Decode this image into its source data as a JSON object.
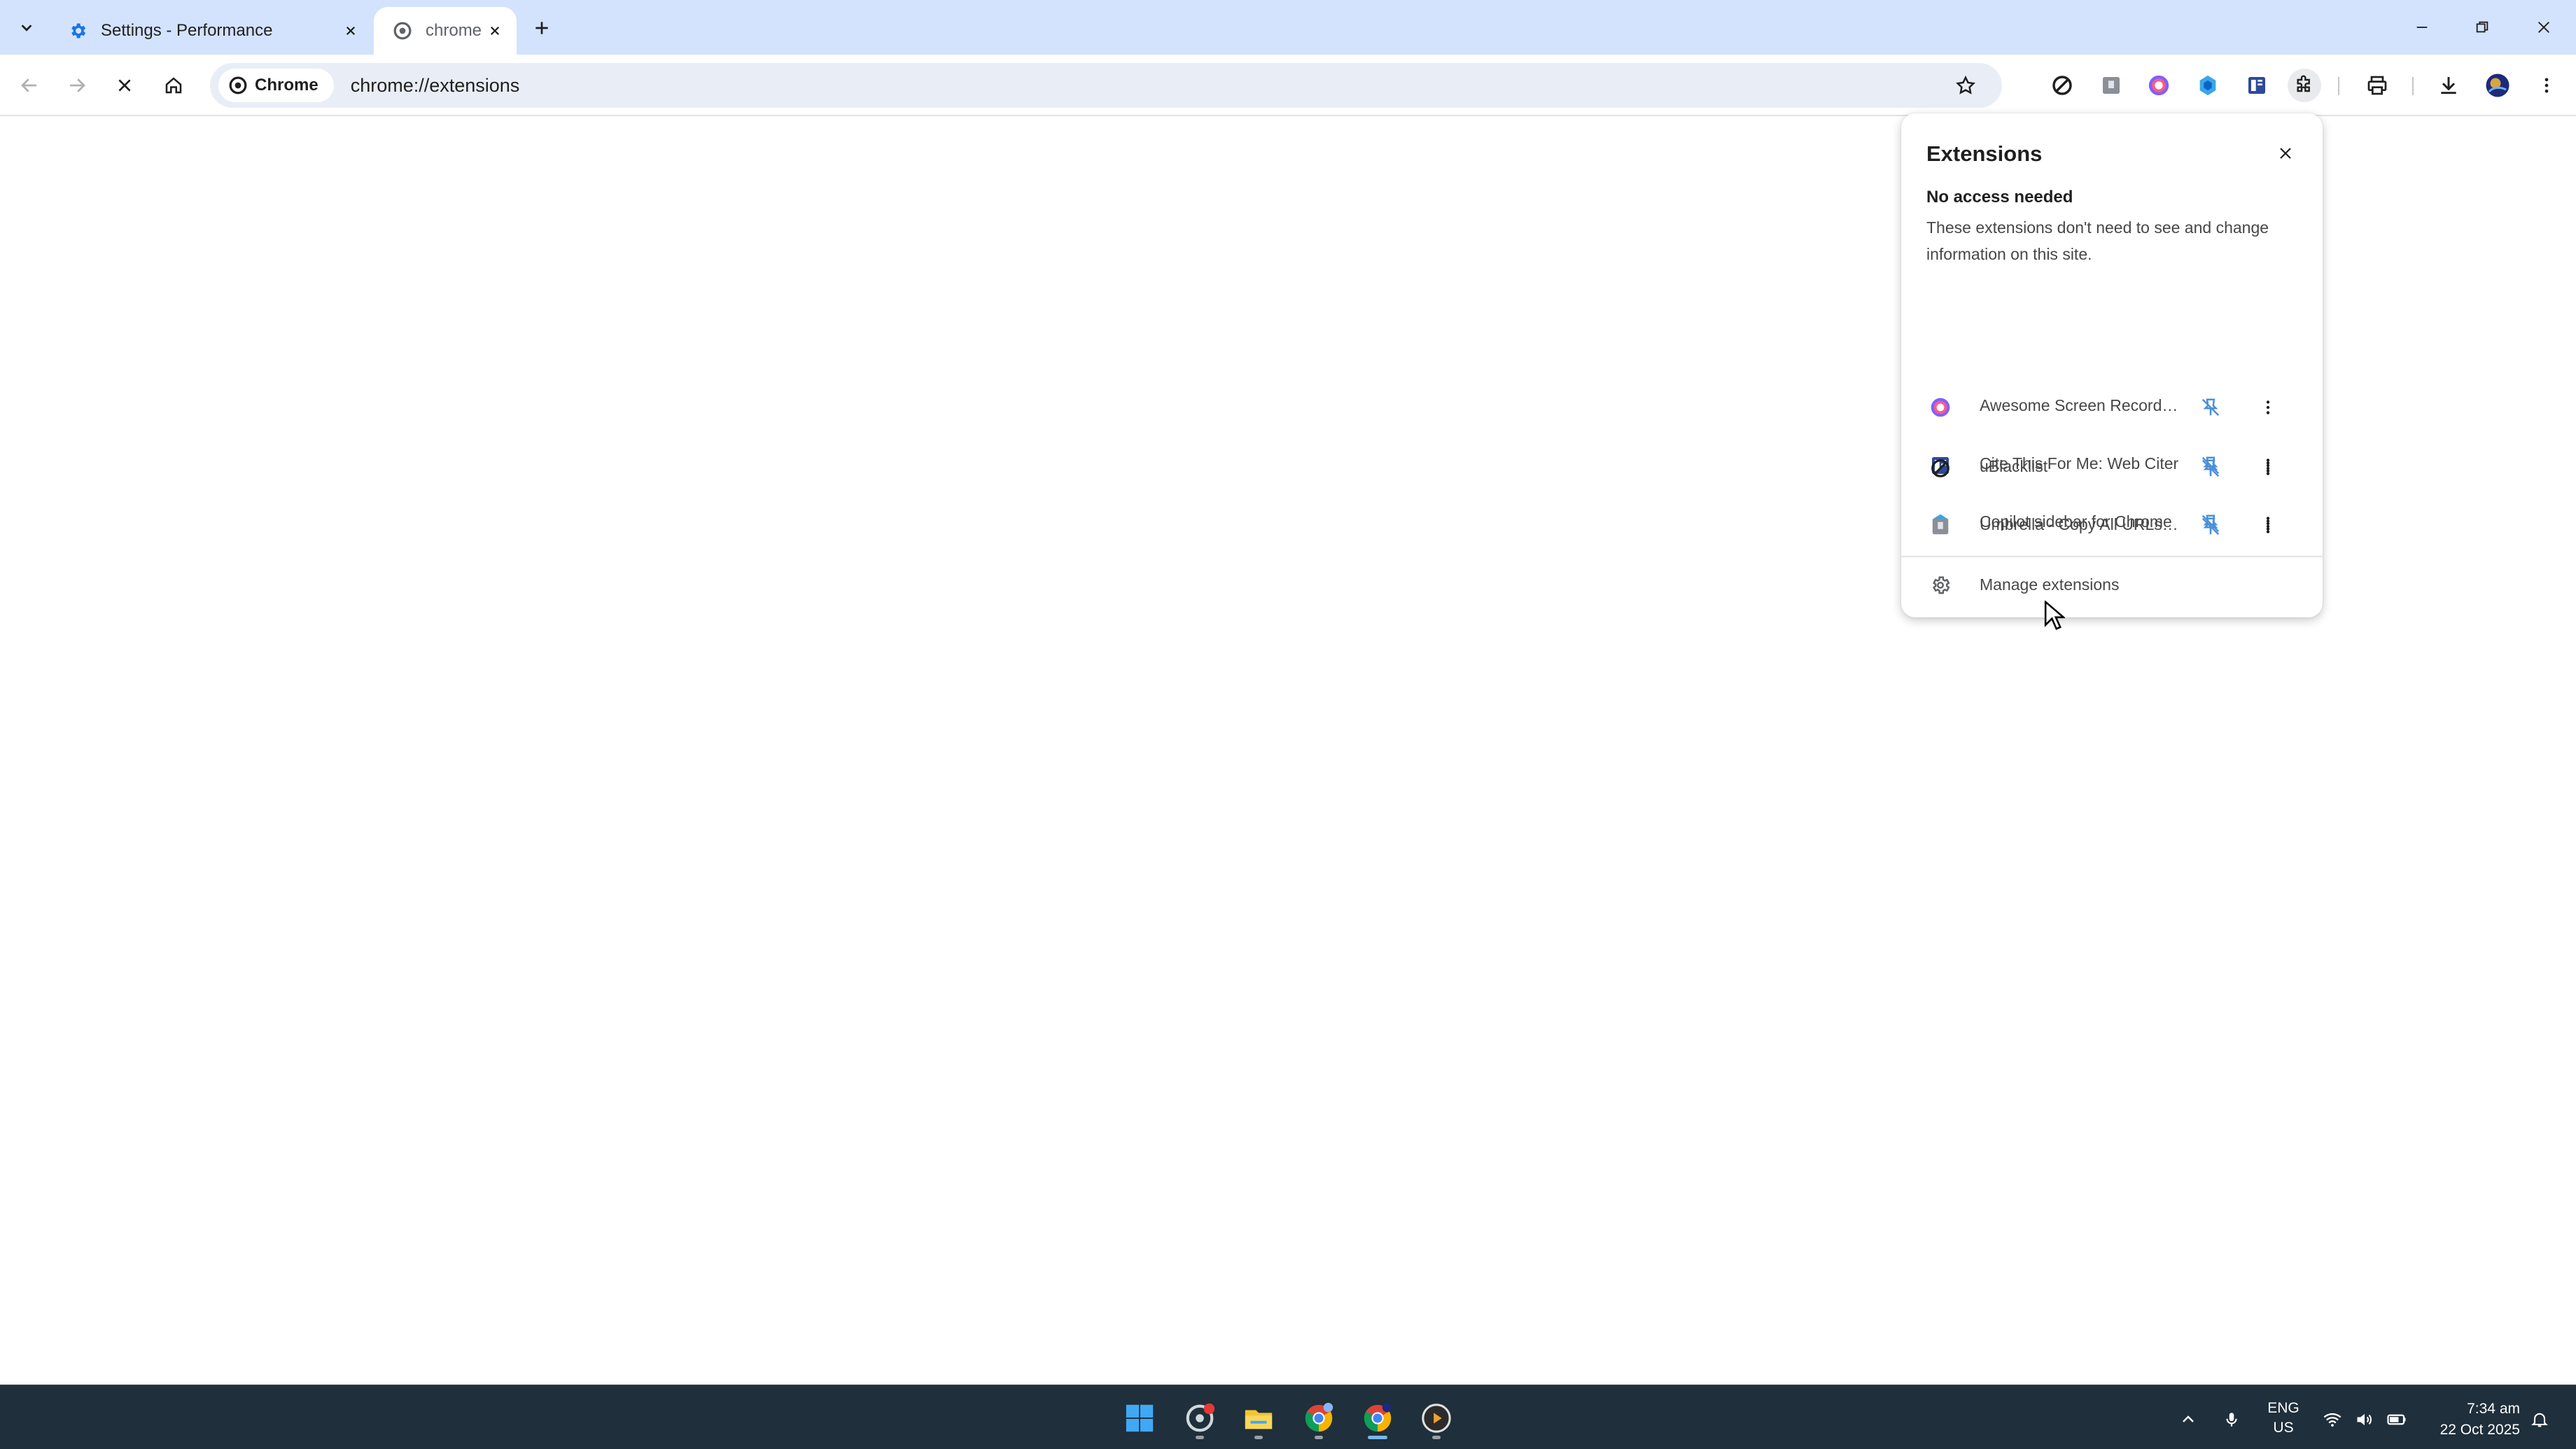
{
  "tabs": [
    {
      "title": "Settings - Performance",
      "icon": "gear-icon",
      "active": false
    },
    {
      "title": "chrome",
      "icon": "chrome-icon",
      "active": true
    }
  ],
  "omnibox": {
    "chip_label": "Chrome",
    "url": "chrome://extensions"
  },
  "popup": {
    "title": "Extensions",
    "section_heading": "No access needed",
    "section_desc": "These extensions don't need to see and change information on this site.",
    "extensions": [
      {
        "name": "Awesome Screen Recorder...",
        "icon": "screen-recorder-icon"
      },
      {
        "name": "Cite This For Me: Web Citer",
        "icon": "cite-this-for-me-icon"
      },
      {
        "name": "Copilot sidebar for Chrome",
        "icon": "copilot-icon"
      },
      {
        "name": "uBlacklist",
        "icon": "ublacklist-icon"
      },
      {
        "name": "Umbrella - Copy All URLs V3",
        "icon": "umbrella-icon"
      }
    ],
    "manage_label": "Manage extensions"
  },
  "taskbar": {
    "lang_top": "ENG",
    "lang_bottom": "US",
    "time": "7:34 am",
    "date": "22 Oct 2025"
  },
  "colors": {
    "tabstrip": "#d3e3fd",
    "taskbar": "#1f2f3b",
    "pin_blue": "#4a90d9"
  }
}
